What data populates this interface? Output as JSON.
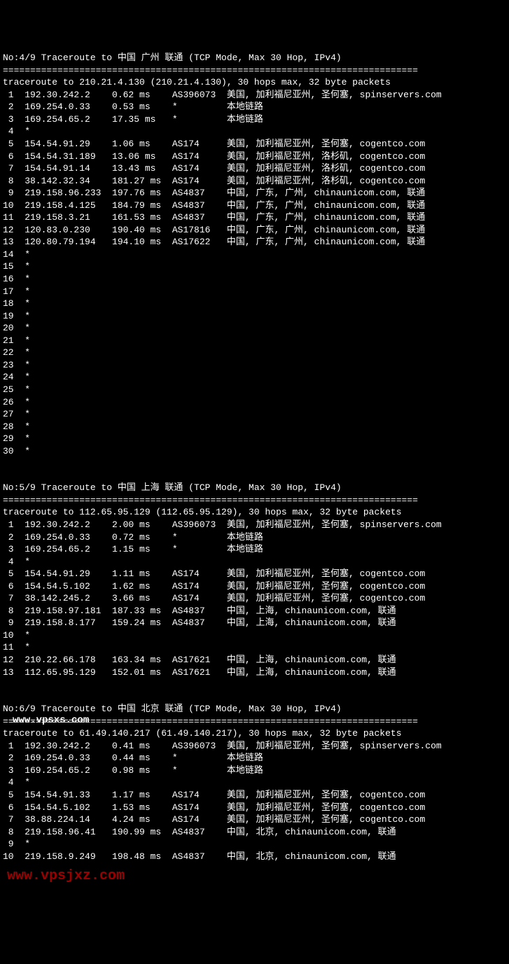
{
  "watermarks": {
    "wm1": "www.vpsxs.com",
    "wm2": "www.vpsjxz.com"
  },
  "traces": [
    {
      "header": "No:4/9 Traceroute to 中国 广州 联通 (TCP Mode, Max 30 Hop, IPv4)",
      "sep": "============================================================================",
      "summary": "traceroute to 210.21.4.130 (210.21.4.130), 30 hops max, 32 byte packets",
      "hops": [
        {
          "n": " 1",
          "ip": "192.30.242.2",
          "rtt": "0.62 ms",
          "asn": "AS396073",
          "loc": "美国, 加利福尼亚州, 圣何塞, spinservers.com"
        },
        {
          "n": " 2",
          "ip": "169.254.0.33",
          "rtt": "0.53 ms",
          "asn": "*",
          "loc": "本地链路"
        },
        {
          "n": " 3",
          "ip": "169.254.65.2",
          "rtt": "17.35 ms",
          "asn": "*",
          "loc": "本地链路"
        },
        {
          "n": " 4",
          "ip": "*",
          "rtt": "",
          "asn": "",
          "loc": ""
        },
        {
          "n": " 5",
          "ip": "154.54.91.29",
          "rtt": "1.06 ms",
          "asn": "AS174",
          "loc": "美国, 加利福尼亚州, 圣何塞, cogentco.com"
        },
        {
          "n": " 6",
          "ip": "154.54.31.189",
          "rtt": "13.06 ms",
          "asn": "AS174",
          "loc": "美国, 加利福尼亚州, 洛杉矶, cogentco.com"
        },
        {
          "n": " 7",
          "ip": "154.54.91.14",
          "rtt": "13.43 ms",
          "asn": "AS174",
          "loc": "美国, 加利福尼亚州, 洛杉矶, cogentco.com"
        },
        {
          "n": " 8",
          "ip": "38.142.32.34",
          "rtt": "181.27 ms",
          "asn": "AS174",
          "loc": "美国, 加利福尼亚州, 洛杉矶, cogentco.com"
        },
        {
          "n": " 9",
          "ip": "219.158.96.233",
          "rtt": "197.76 ms",
          "asn": "AS4837",
          "loc": "中国, 广东, 广州, chinaunicom.com, 联通"
        },
        {
          "n": "10",
          "ip": "219.158.4.125",
          "rtt": "184.79 ms",
          "asn": "AS4837",
          "loc": "中国, 广东, 广州, chinaunicom.com, 联通"
        },
        {
          "n": "11",
          "ip": "219.158.3.21",
          "rtt": "161.53 ms",
          "asn": "AS4837",
          "loc": "中国, 广东, 广州, chinaunicom.com, 联通"
        },
        {
          "n": "12",
          "ip": "120.83.0.230",
          "rtt": "190.40 ms",
          "asn": "AS17816",
          "loc": "中国, 广东, 广州, chinaunicom.com, 联通"
        },
        {
          "n": "13",
          "ip": "120.80.79.194",
          "rtt": "194.10 ms",
          "asn": "AS17622",
          "loc": "中国, 广东, 广州, chinaunicom.com, 联通"
        },
        {
          "n": "14",
          "ip": "*",
          "rtt": "",
          "asn": "",
          "loc": ""
        },
        {
          "n": "15",
          "ip": "*",
          "rtt": "",
          "asn": "",
          "loc": ""
        },
        {
          "n": "16",
          "ip": "*",
          "rtt": "",
          "asn": "",
          "loc": ""
        },
        {
          "n": "17",
          "ip": "*",
          "rtt": "",
          "asn": "",
          "loc": ""
        },
        {
          "n": "18",
          "ip": "*",
          "rtt": "",
          "asn": "",
          "loc": ""
        },
        {
          "n": "19",
          "ip": "*",
          "rtt": "",
          "asn": "",
          "loc": ""
        },
        {
          "n": "20",
          "ip": "*",
          "rtt": "",
          "asn": "",
          "loc": ""
        },
        {
          "n": "21",
          "ip": "*",
          "rtt": "",
          "asn": "",
          "loc": ""
        },
        {
          "n": "22",
          "ip": "*",
          "rtt": "",
          "asn": "",
          "loc": ""
        },
        {
          "n": "23",
          "ip": "*",
          "rtt": "",
          "asn": "",
          "loc": ""
        },
        {
          "n": "24",
          "ip": "*",
          "rtt": "",
          "asn": "",
          "loc": ""
        },
        {
          "n": "25",
          "ip": "*",
          "rtt": "",
          "asn": "",
          "loc": ""
        },
        {
          "n": "26",
          "ip": "*",
          "rtt": "",
          "asn": "",
          "loc": ""
        },
        {
          "n": "27",
          "ip": "*",
          "rtt": "",
          "asn": "",
          "loc": ""
        },
        {
          "n": "28",
          "ip": "*",
          "rtt": "",
          "asn": "",
          "loc": ""
        },
        {
          "n": "29",
          "ip": "*",
          "rtt": "",
          "asn": "",
          "loc": ""
        },
        {
          "n": "30",
          "ip": "*",
          "rtt": "",
          "asn": "",
          "loc": ""
        }
      ]
    },
    {
      "header": "No:5/9 Traceroute to 中国 上海 联通 (TCP Mode, Max 30 Hop, IPv4)",
      "sep": "============================================================================",
      "summary": "traceroute to 112.65.95.129 (112.65.95.129), 30 hops max, 32 byte packets",
      "hops": [
        {
          "n": " 1",
          "ip": "192.30.242.2",
          "rtt": "2.00 ms",
          "asn": "AS396073",
          "loc": "美国, 加利福尼亚州, 圣何塞, spinservers.com"
        },
        {
          "n": " 2",
          "ip": "169.254.0.33",
          "rtt": "0.72 ms",
          "asn": "*",
          "loc": "本地链路"
        },
        {
          "n": " 3",
          "ip": "169.254.65.2",
          "rtt": "1.15 ms",
          "asn": "*",
          "loc": "本地链路"
        },
        {
          "n": " 4",
          "ip": "*",
          "rtt": "",
          "asn": "",
          "loc": ""
        },
        {
          "n": " 5",
          "ip": "154.54.91.29",
          "rtt": "1.11 ms",
          "asn": "AS174",
          "loc": "美国, 加利福尼亚州, 圣何塞, cogentco.com"
        },
        {
          "n": " 6",
          "ip": "154.54.5.102",
          "rtt": "1.62 ms",
          "asn": "AS174",
          "loc": "美国, 加利福尼亚州, 圣何塞, cogentco.com"
        },
        {
          "n": " 7",
          "ip": "38.142.245.2",
          "rtt": "3.66 ms",
          "asn": "AS174",
          "loc": "美国, 加利福尼亚州, 圣何塞, cogentco.com"
        },
        {
          "n": " 8",
          "ip": "219.158.97.181",
          "rtt": "187.33 ms",
          "asn": "AS4837",
          "loc": "中国, 上海, chinaunicom.com, 联通"
        },
        {
          "n": " 9",
          "ip": "219.158.8.177",
          "rtt": "159.24 ms",
          "asn": "AS4837",
          "loc": "中国, 上海, chinaunicom.com, 联通"
        },
        {
          "n": "10",
          "ip": "*",
          "rtt": "",
          "asn": "",
          "loc": ""
        },
        {
          "n": "11",
          "ip": "*",
          "rtt": "",
          "asn": "",
          "loc": ""
        },
        {
          "n": "12",
          "ip": "210.22.66.178",
          "rtt": "163.34 ms",
          "asn": "AS17621",
          "loc": "中国, 上海, chinaunicom.com, 联通"
        },
        {
          "n": "13",
          "ip": "112.65.95.129",
          "rtt": "152.01 ms",
          "asn": "AS17621",
          "loc": "中国, 上海, chinaunicom.com, 联通"
        }
      ]
    },
    {
      "header": "No:6/9 Traceroute to 中国 北京 联通 (TCP Mode, Max 30 Hop, IPv4)",
      "sep": "============================================================================",
      "summary": "traceroute to 61.49.140.217 (61.49.140.217), 30 hops max, 32 byte packets",
      "hops": [
        {
          "n": " 1",
          "ip": "192.30.242.2",
          "rtt": "0.41 ms",
          "asn": "AS396073",
          "loc": "美国, 加利福尼亚州, 圣何塞, spinservers.com"
        },
        {
          "n": " 2",
          "ip": "169.254.0.33",
          "rtt": "0.44 ms",
          "asn": "*",
          "loc": "本地链路"
        },
        {
          "n": " 3",
          "ip": "169.254.65.2",
          "rtt": "0.98 ms",
          "asn": "*",
          "loc": "本地链路"
        },
        {
          "n": " 4",
          "ip": "*",
          "rtt": "",
          "asn": "",
          "loc": ""
        },
        {
          "n": " 5",
          "ip": "154.54.91.33",
          "rtt": "1.17 ms",
          "asn": "AS174",
          "loc": "美国, 加利福尼亚州, 圣何塞, cogentco.com"
        },
        {
          "n": " 6",
          "ip": "154.54.5.102",
          "rtt": "1.53 ms",
          "asn": "AS174",
          "loc": "美国, 加利福尼亚州, 圣何塞, cogentco.com"
        },
        {
          "n": " 7",
          "ip": "38.88.224.14",
          "rtt": "4.24 ms",
          "asn": "AS174",
          "loc": "美国, 加利福尼亚州, 圣何塞, cogentco.com"
        },
        {
          "n": " 8",
          "ip": "219.158.96.41",
          "rtt": "190.99 ms",
          "asn": "AS4837",
          "loc": "中国, 北京, chinaunicom.com, 联通"
        },
        {
          "n": " 9",
          "ip": "*",
          "rtt": "",
          "asn": "",
          "loc": ""
        },
        {
          "n": "10",
          "ip": "219.158.9.249",
          "rtt": "198.48 ms",
          "asn": "AS4837",
          "loc": "中国, 北京, chinaunicom.com, 联通"
        }
      ]
    }
  ]
}
